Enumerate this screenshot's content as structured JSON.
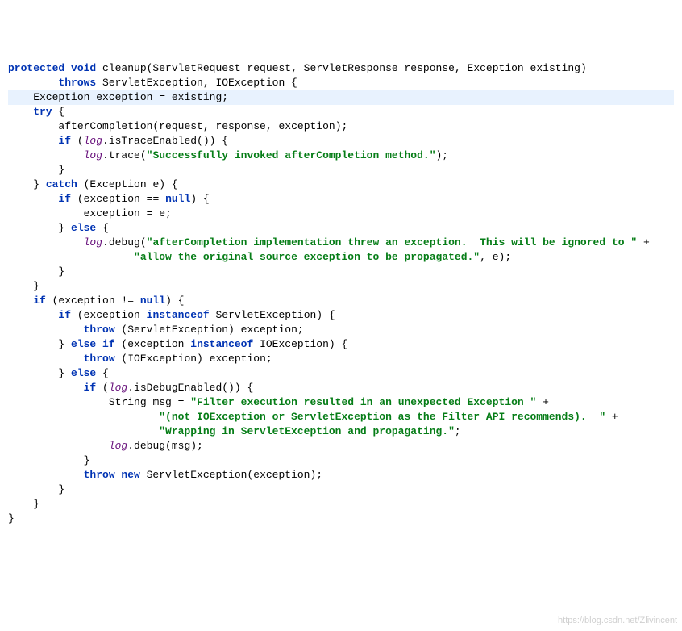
{
  "code": {
    "l1a": "protected void",
    "l1b": " cleanup(ServletRequest ",
    "l1c": "request",
    "l1d": ", ServletResponse ",
    "l1e": "response",
    "l1f": ", Exception ",
    "l1g": "existing",
    "l1h": ")",
    "l2a": "        throws",
    "l2b": " ServletException, IOException {",
    "l3a": "    Exception ",
    "l3b": "exception",
    "l3c": " = ",
    "l3d": "existing",
    "l3e": ";",
    "l4a": "    try",
    "l4b": " {",
    "l5a": "        afterCompletion(",
    "l5b": "request",
    "l5c": ", ",
    "l5d": "response",
    "l5e": ", ",
    "l5f": "exception",
    "l5g": ");",
    "l6a": "        if",
    "l6b": " (",
    "l6c": "log",
    "l6d": ".isTraceEnabled()) {",
    "l7a": "            ",
    "l7b": "log",
    "l7c": ".trace(",
    "l7d": "\"Successfully invoked afterCompletion method.\"",
    "l7e": ");",
    "l8": "        }",
    "l9a": "    } ",
    "l9b": "catch",
    "l9c": " (Exception ",
    "l9d": "e",
    "l9e": ") {",
    "l10a": "        if",
    "l10b": " (",
    "l10c": "exception",
    "l10d": " == ",
    "l10e": "null",
    "l10f": ") {",
    "l11a": "            ",
    "l11b": "exception",
    "l11c": " = ",
    "l11d": "e",
    "l11e": ";",
    "l12a": "        } ",
    "l12b": "else",
    "l12c": " {",
    "l13a": "            ",
    "l13b": "log",
    "l13c": ".debug(",
    "l13d": "\"afterCompletion implementation threw an exception.  This will be ignored to \"",
    "l13e": " +",
    "l14a": "                    ",
    "l14b": "\"allow the original source exception to be propagated.\"",
    "l14c": ", ",
    "l14d": "e",
    "l14e": ");",
    "l15": "        }",
    "l16": "    }",
    "l17a": "    if",
    "l17b": " (",
    "l17c": "exception",
    "l17d": " != ",
    "l17e": "null",
    "l17f": ") {",
    "l18a": "        if",
    "l18b": " (",
    "l18c": "exception",
    "l18d": " ",
    "l18e": "instanceof",
    "l18f": " ServletException) {",
    "l19a": "            throw",
    "l19b": " (ServletException) ",
    "l19c": "exception",
    "l19d": ";",
    "l20a": "        } ",
    "l20b": "else if",
    "l20c": " (",
    "l20d": "exception",
    "l20e": " ",
    "l20f": "instanceof",
    "l20g": " IOException) {",
    "l21a": "            throw",
    "l21b": " (IOException) ",
    "l21c": "exception",
    "l21d": ";",
    "l22a": "        } ",
    "l22b": "else",
    "l22c": " {",
    "l23a": "            if",
    "l23b": " (",
    "l23c": "log",
    "l23d": ".isDebugEnabled()) {",
    "l24a": "                String ",
    "l24b": "msg",
    "l24c": " = ",
    "l24d": "\"Filter execution resulted in an unexpected Exception \"",
    "l24e": " +",
    "l25a": "                        ",
    "l25b": "\"(not IOException or ServletException as the Filter API recommends).  \"",
    "l25c": " +",
    "l26a": "                        ",
    "l26b": "\"Wrapping in ServletException and propagating.\"",
    "l26c": ";",
    "l27a": "                ",
    "l27b": "log",
    "l27c": ".debug(",
    "l27d": "msg",
    "l27e": ");",
    "l28": "            }",
    "l29a": "            throw new",
    "l29b": " ServletException(",
    "l29c": "exception",
    "l29d": ");",
    "l30": "        }",
    "l31": "    }",
    "l32": "}"
  },
  "watermark": "https://blog.csdn.net/Zlivincent"
}
